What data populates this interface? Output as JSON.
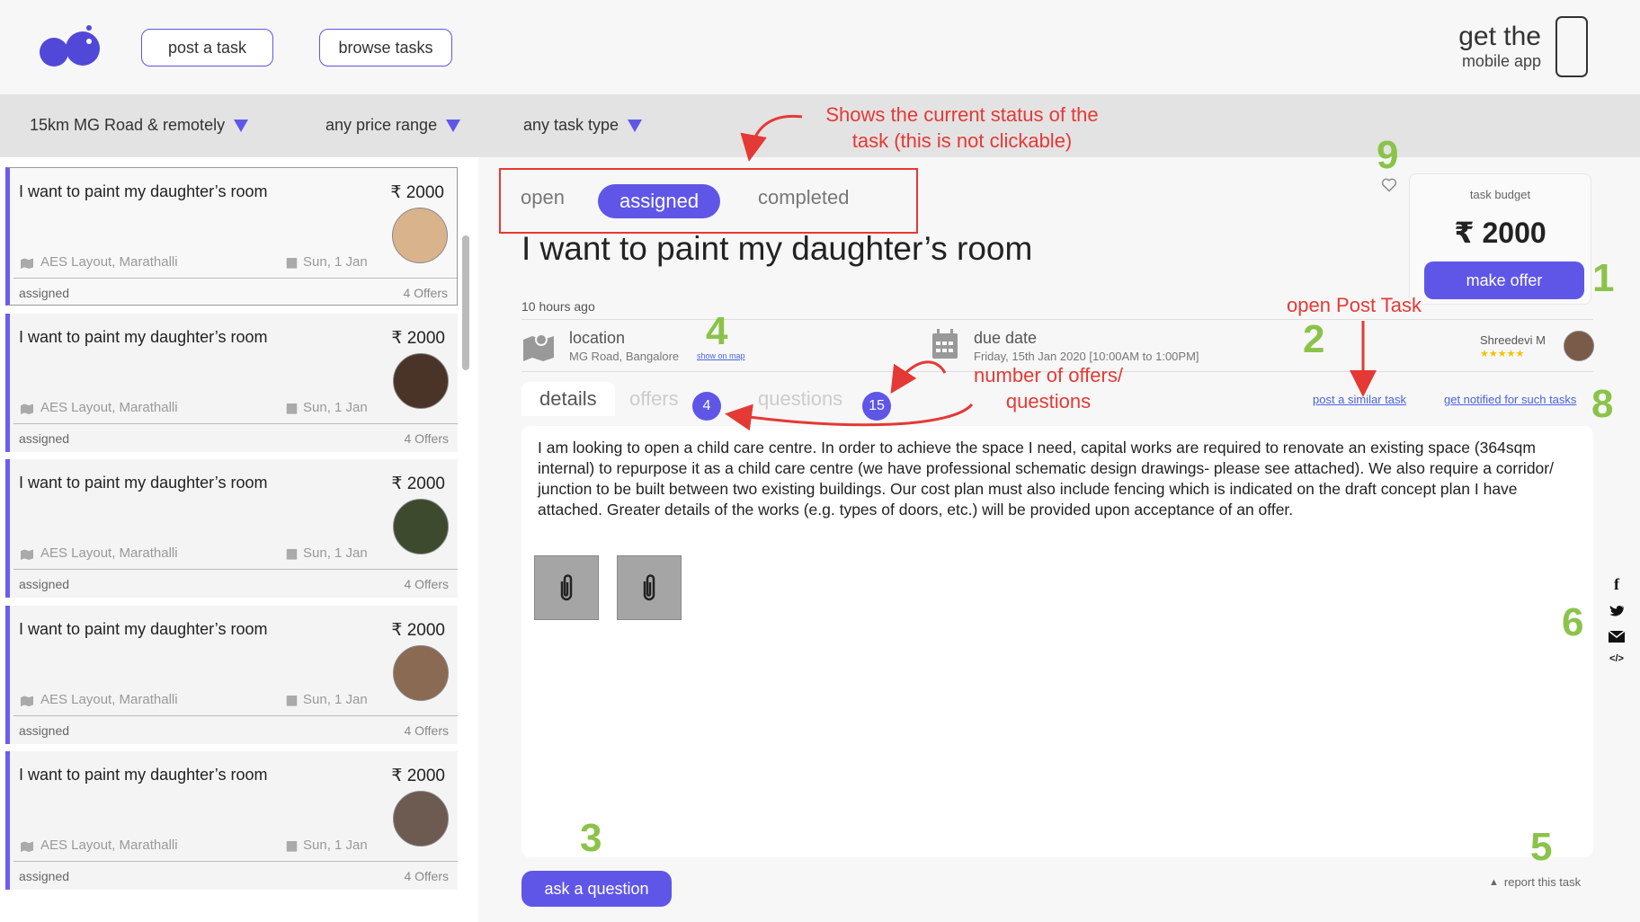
{
  "header": {
    "post_task": "post a task",
    "browse_tasks": "browse tasks",
    "get_the": "get the",
    "mobile_app": "mobile app"
  },
  "filters": {
    "location": "15km MG Road & remotely",
    "price": "any price range",
    "type": "any task type"
  },
  "task_list": [
    {
      "title": "I want to paint my daughter’s room",
      "price": "₹ 2000",
      "location": "AES Layout, Marathalli",
      "date": "Sun, 1 Jan",
      "status": "assigned",
      "offers": "4 Offers",
      "avatar_color": "#d9b38c"
    },
    {
      "title": "I want to paint my daughter’s room",
      "price": "₹ 2000",
      "location": "AES Layout, Marathalli",
      "date": "Sun, 1 Jan",
      "status": "assigned",
      "offers": "4 Offers",
      "avatar_color": "#4a3428"
    },
    {
      "title": "I want to paint my daughter’s room",
      "price": "₹ 2000",
      "location": "AES Layout, Marathalli",
      "date": "Sun, 1 Jan",
      "status": "assigned",
      "offers": "4 Offers",
      "avatar_color": "#3d4a2e"
    },
    {
      "title": "I want to paint my daughter’s room",
      "price": "₹ 2000",
      "location": "AES Layout, Marathalli",
      "date": "Sun, 1 Jan",
      "status": "assigned",
      "offers": "4 Offers",
      "avatar_color": "#8a6a52"
    },
    {
      "title": "I want to paint my daughter’s room",
      "price": "₹ 2000",
      "location": "AES Layout, Marathalli",
      "date": "Sun, 1 Jan",
      "status": "assigned",
      "offers": "4 Offers",
      "avatar_color": "#6d5a50"
    }
  ],
  "status_tabs": {
    "open": "open",
    "assigned": "assigned",
    "completed": "completed"
  },
  "task": {
    "title": "I want to paint my daughter’s room",
    "time_ago": "10 hours ago",
    "location_label": "location",
    "location_value": "MG Road, Bangalore",
    "show_on_map": "show on map",
    "due_label": "due date",
    "due_value": "Friday, 15th Jan 2020 [10:00AM to 1:00PM]",
    "poster_name": "Shreedevi M",
    "poster_stars": "★★★★★",
    "post_similar": "post a similar task",
    "get_notified": "get notified for such tasks",
    "description": "I am looking to open a child care centre. In order to achieve the space I need, capital works are required to renovate an existing space (364sqm internal) to repurpose it as a child care centre (we have professional schematic design drawings- please see attached). We also require a corridor/ junction to be built between two existing buildings. Our cost plan must also include fencing which is indicated on the draft concept plan I have attached. Greater details of the works (e.g. types of doors, etc.) will be provided upon acceptance of an offer.",
    "ask_question": "ask a question",
    "report": "report this task"
  },
  "budget": {
    "label": "task budget",
    "amount": "₹ 2000",
    "make_offer": "make offer"
  },
  "content_tabs": {
    "details": "details",
    "offers": "offers",
    "offers_count": "4",
    "questions": "questions",
    "questions_count": "15"
  },
  "annotations": {
    "status_note_1": "Shows the current status of the",
    "status_note_2": "task (this is not clickable)",
    "open_post_task": "open Post Task",
    "num_offers_1": "number of offers/",
    "num_offers_2": "questions",
    "n1": "1",
    "n2": "2",
    "n3": "3",
    "n4": "4",
    "n5": "5",
    "n6": "6",
    "n8": "8",
    "n9": "9"
  },
  "colors": {
    "accent": "#5f56e8",
    "annotation_red": "#e53935",
    "annotation_green": "#8bc34a"
  }
}
